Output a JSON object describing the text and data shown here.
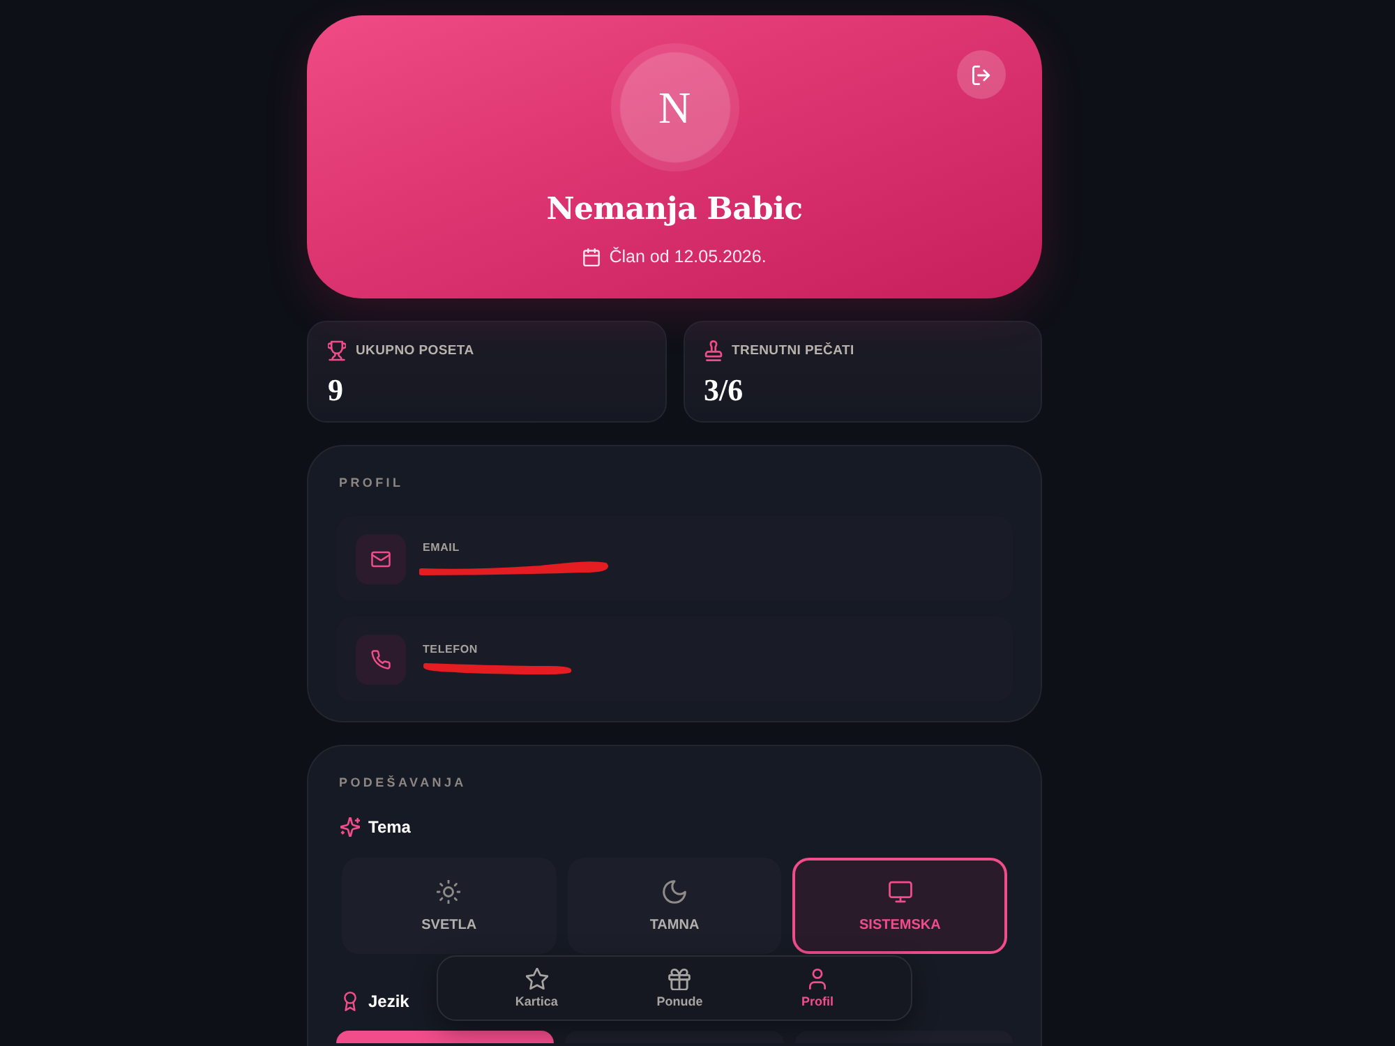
{
  "header": {
    "avatar_initial": "N",
    "name": "Nemanja Babic",
    "member_since": "Član od 12.05.2026."
  },
  "stats": [
    {
      "kind": "visits",
      "label": "UKUPNO POSETA",
      "value": "9"
    },
    {
      "kind": "stamps",
      "label": "TRENUTNI PEČATI",
      "value": "3/6"
    }
  ],
  "profile": {
    "title": "PROFIL",
    "contacts": [
      {
        "kind": "email",
        "label": "EMAIL",
        "redacted": true
      },
      {
        "kind": "phone",
        "label": "TELEFON",
        "redacted": true
      }
    ]
  },
  "settings": {
    "title": "PODEŠAVANJA",
    "theme": {
      "label": "Tema",
      "options": [
        {
          "kind": "light",
          "label": "SVETLA",
          "selected": false
        },
        {
          "kind": "dark",
          "label": "TAMNA",
          "selected": false
        },
        {
          "kind": "system",
          "label": "SISTEMSKA",
          "selected": true
        }
      ]
    },
    "language": {
      "label": "Jezik",
      "options": [
        {
          "selected": true
        },
        {
          "selected": false
        },
        {
          "selected": false
        }
      ]
    }
  },
  "bottom_nav": [
    {
      "kind": "card",
      "label": "Kartica",
      "selected": false
    },
    {
      "kind": "offers",
      "label": "Ponude",
      "selected": false
    },
    {
      "kind": "profile",
      "label": "Profil",
      "selected": true
    }
  ]
}
